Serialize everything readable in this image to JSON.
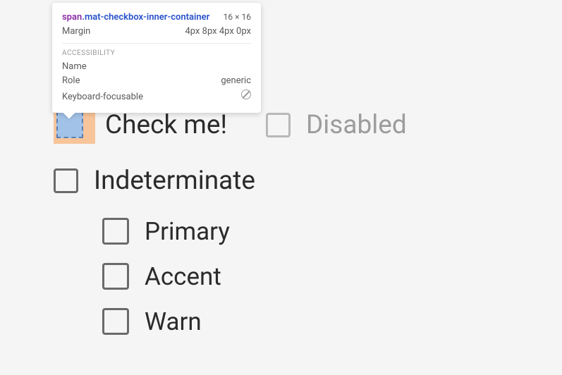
{
  "tooltip": {
    "selector_tag": "span",
    "selector_class": ".mat-checkbox-inner-container",
    "dimensions": "16 × 16",
    "margin_label": "Margin",
    "margin_value": "4px 8px 4px 0px",
    "section_label": "ACCESSIBILITY",
    "name_label": "Name",
    "name_value": "",
    "role_label": "Role",
    "role_value": "generic",
    "kbf_label": "Keyboard-focusable"
  },
  "checkboxes": {
    "checkme": "Check me!",
    "disabled": "Disabled",
    "indeterminate": "Indeterminate",
    "primary": "Primary",
    "accent": "Accent",
    "warn": "Warn"
  }
}
